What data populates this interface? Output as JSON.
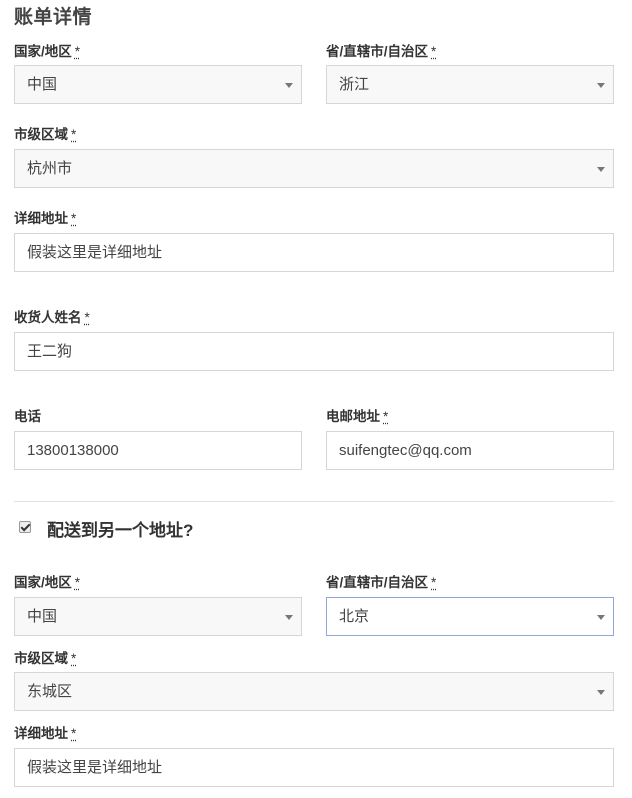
{
  "section_title": "账单详情",
  "required_mark": "*",
  "billing": {
    "country": {
      "label": "国家/地区",
      "value": "中国"
    },
    "province": {
      "label": "省/直辖市/自治区",
      "value": "浙江"
    },
    "city": {
      "label": "市级区域",
      "value": "杭州市"
    },
    "address": {
      "label": "详细地址",
      "value": "假装这里是详细地址"
    },
    "name": {
      "label": "收货人姓名",
      "value": "王二狗"
    },
    "phone": {
      "label": "电话",
      "value": "13800138000"
    },
    "email": {
      "label": "电邮地址",
      "value": "suifengtec@qq.com"
    }
  },
  "ship_to_different": {
    "label": "配送到另一个地址?",
    "checked": true
  },
  "shipping": {
    "country": {
      "label": "国家/地区",
      "value": "中国"
    },
    "province": {
      "label": "省/直辖市/自治区",
      "value": "北京"
    },
    "city": {
      "label": "市级区域",
      "value": "东城区"
    },
    "address": {
      "label": "详细地址",
      "value": "假装这里是详细地址"
    }
  }
}
